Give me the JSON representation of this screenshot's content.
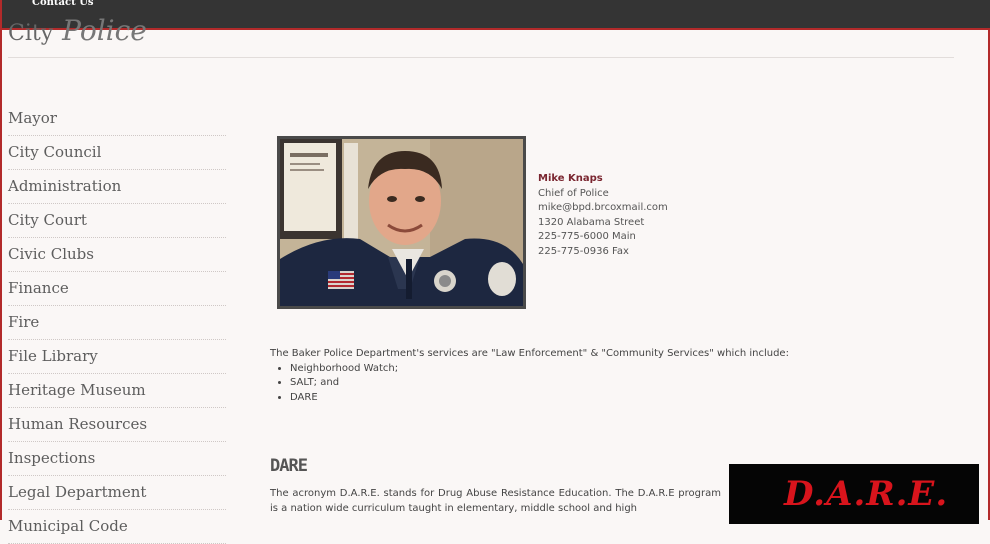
{
  "header": {
    "contact_link": "Contact Us",
    "site_title_plain": "City",
    "site_title_script": "Police"
  },
  "sidebar": {
    "items": [
      {
        "label": "Mayor"
      },
      {
        "label": "City Council"
      },
      {
        "label": "Administration"
      },
      {
        "label": "City Court"
      },
      {
        "label": "Civic Clubs"
      },
      {
        "label": "Finance"
      },
      {
        "label": "Fire"
      },
      {
        "label": "File Library"
      },
      {
        "label": "Heritage Museum"
      },
      {
        "label": "Human Resources"
      },
      {
        "label": "Inspections"
      },
      {
        "label": "Legal Department"
      },
      {
        "label": "Municipal Code"
      }
    ]
  },
  "chief": {
    "name": "Mike Knaps",
    "title": "Chief of Police",
    "email": "mike@bpd.brcoxmail.com",
    "address": "1320 Alabama Street",
    "phone_main": "225-775-6000 Main",
    "phone_fax": "225-775-0936 Fax"
  },
  "services": {
    "intro": "The Baker Police Department's services are \"Law Enforcement\" & \"Community Services\" which include:",
    "items": [
      "Neighborhood Watch;",
      "SALT; and",
      "DARE"
    ]
  },
  "dare": {
    "heading": "DARE",
    "text": "The acronym D.A.R.E. stands for Drug Abuse Resistance Education. The D.A.R.E program is a nation wide curriculum taught in elementary, middle school and high",
    "logo_text": "D.A.R.E."
  },
  "colors": {
    "topbar": "#343434",
    "accent": "#b22a2a",
    "name_color": "#7a2630",
    "logo_red": "#d8141c"
  }
}
